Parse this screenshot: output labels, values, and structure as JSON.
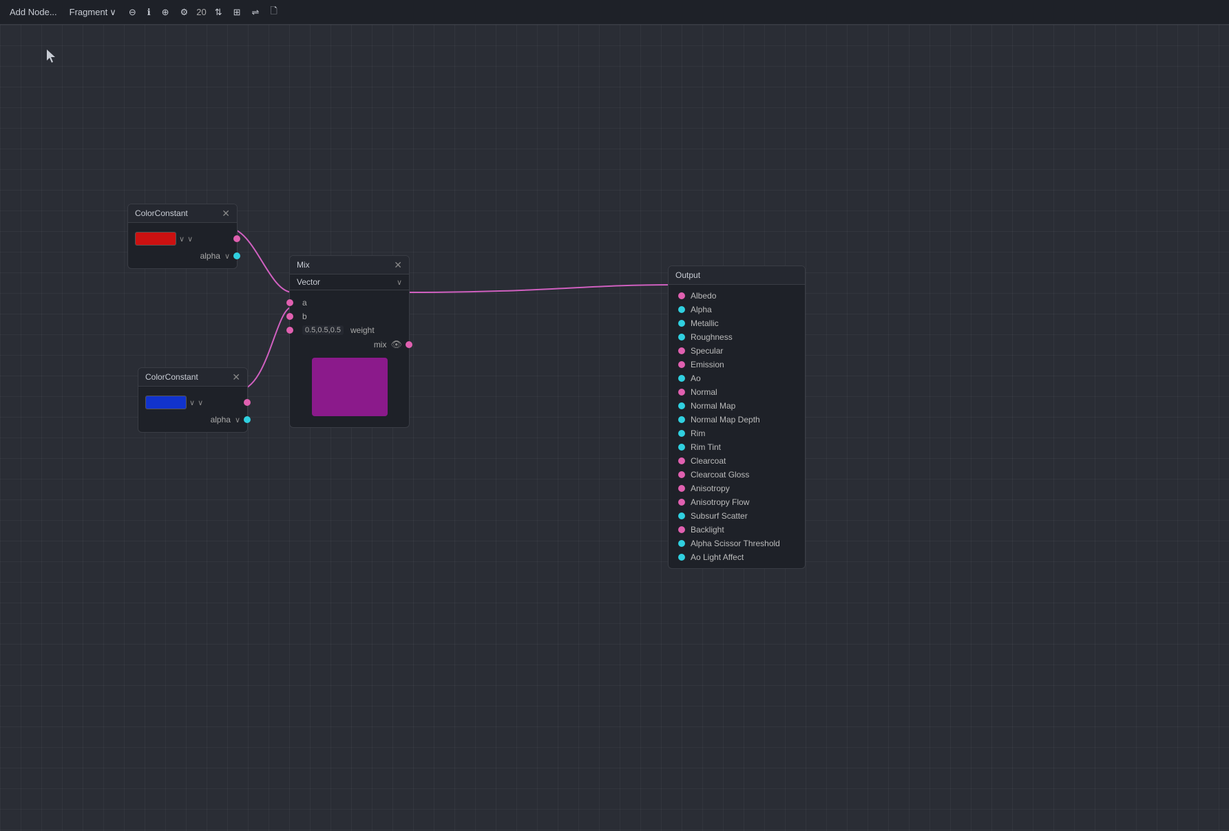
{
  "toolbar": {
    "add_node_label": "Add Node...",
    "fragment_label": "Fragment",
    "zoom_level": "20",
    "icons": {
      "minus": "⊖",
      "plus_circle": "⊕",
      "zoom_in": "⊕",
      "settings": "⚙",
      "grid": "⊞",
      "align": "⇌",
      "file": "🗋",
      "chevron_down": "∨"
    }
  },
  "nodes": {
    "color_const_1": {
      "title": "ColorConstant",
      "color": "#cc1111",
      "alpha_label": "alpha"
    },
    "color_const_2": {
      "title": "ColorConstant",
      "color": "#1133cc",
      "alpha_label": "alpha"
    },
    "mix": {
      "title": "Mix",
      "type_label": "Vector",
      "port_a": "a",
      "port_b": "b",
      "port_weight": "weight",
      "weight_value": "0.5,0.5,0.5",
      "mix_label": "mix",
      "preview_color": "#8b1a8b"
    },
    "output": {
      "title": "Output",
      "ports": [
        "Albedo",
        "Alpha",
        "Metallic",
        "Roughness",
        "Specular",
        "Emission",
        "Ao",
        "Normal",
        "Normal Map",
        "Normal Map Depth",
        "Rim",
        "Rim Tint",
        "Clearcoat",
        "Clearcoat Gloss",
        "Anisotropy",
        "Anisotropy Flow",
        "Subsurf Scatter",
        "Backlight",
        "Alpha Scissor Threshold",
        "Ao Light Affect"
      ]
    }
  }
}
